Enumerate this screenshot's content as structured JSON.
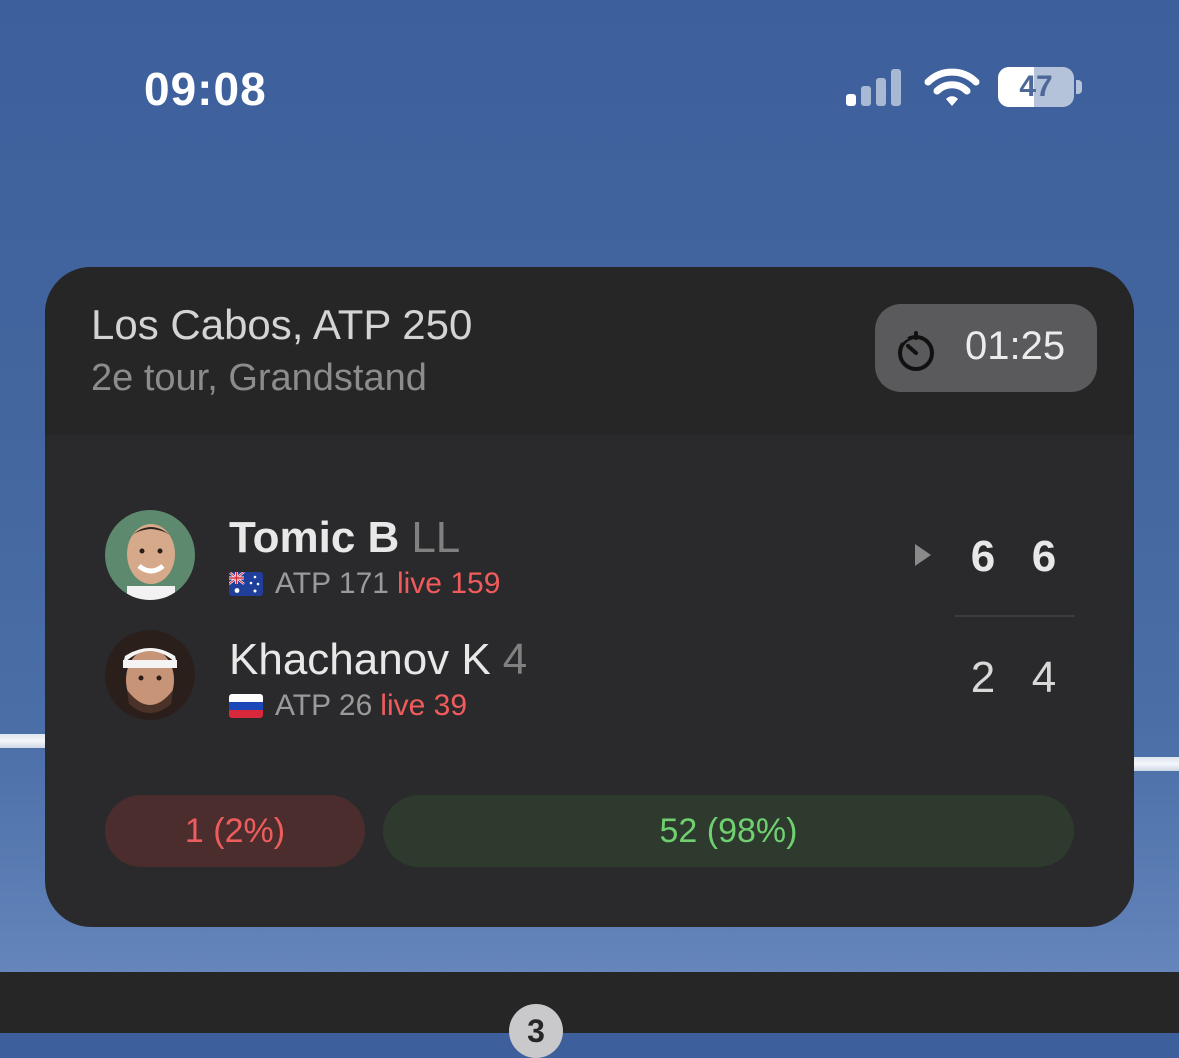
{
  "status_bar": {
    "time": "09:08",
    "battery_level": "47",
    "battery_fraction": 0.47,
    "signal_bars": 1,
    "signal_bars_total": 4
  },
  "match": {
    "tournament": "Los Cabos, ATP 250",
    "round": "2e tour, Grandstand",
    "duration": "01:25",
    "players": [
      {
        "name": "Tomic B",
        "seed": "LL",
        "country": "Australia",
        "ranking_label": "ATP 171",
        "live_label": "live 159",
        "serving": true,
        "scores": [
          "6",
          "6"
        ],
        "name_weight": "bold"
      },
      {
        "name": "Khachanov K",
        "seed": "4",
        "country": "Russia",
        "ranking_label": "ATP 26",
        "live_label": "live 39",
        "serving": false,
        "scores": [
          "2",
          "4"
        ],
        "name_weight": "normal"
      }
    ],
    "votes": {
      "left_label": "1 (2%)",
      "right_label": "52 (98%)",
      "left_fraction": 0.02,
      "right_fraction": 0.98
    }
  },
  "dock": {
    "page_badge": "3"
  },
  "colors": {
    "widget_bg": "#2a2a2c",
    "live_red": "#f15b5b",
    "vote_green": "#6fd06f",
    "vote_red": "#ee5d5d"
  },
  "icons": {
    "timer": "stopwatch-icon",
    "serve": "play-triangle-icon",
    "signal": "cellular-signal-icon",
    "wifi": "wifi-icon",
    "battery": "battery-icon"
  }
}
